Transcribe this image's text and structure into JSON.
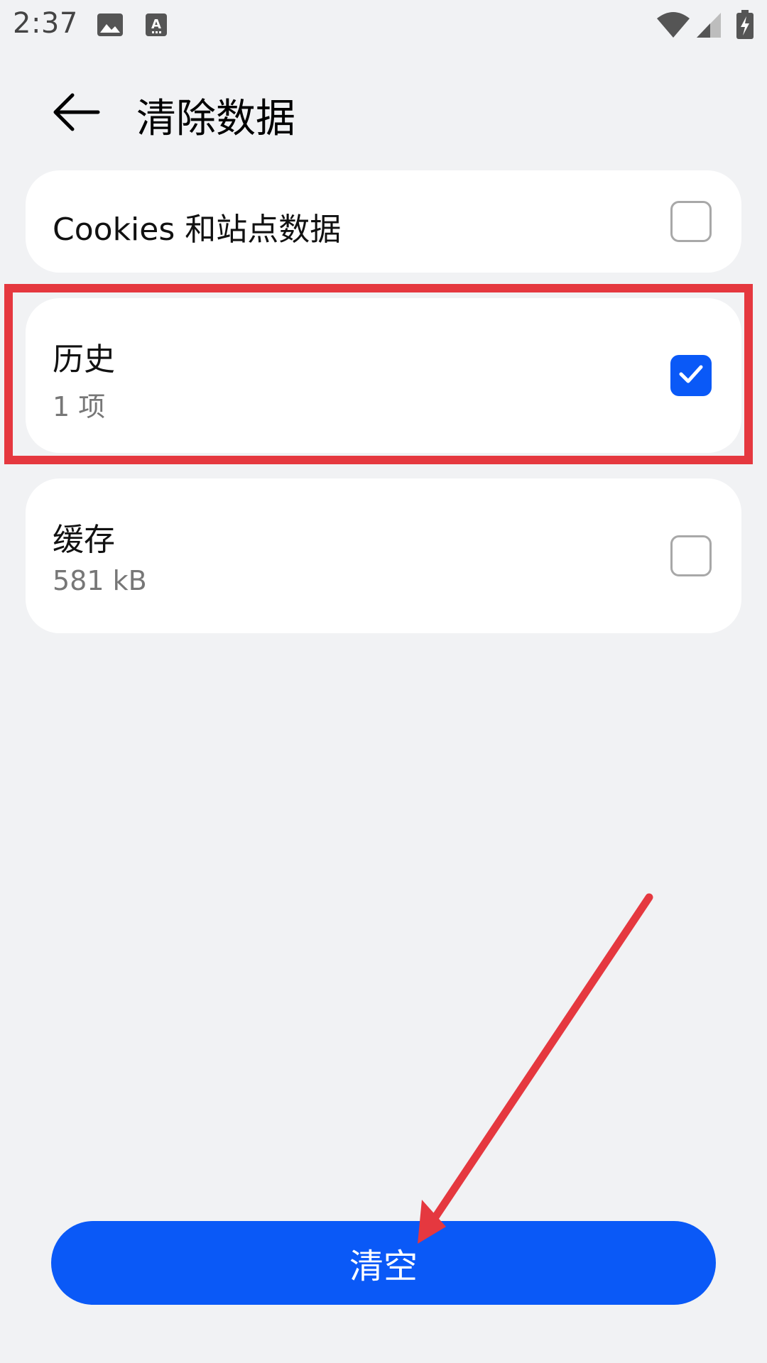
{
  "status_bar": {
    "time": "2:37",
    "icons": [
      "image-icon",
      "keyboard-a-icon",
      "wifi-icon",
      "signal-icon",
      "battery-charging-icon"
    ]
  },
  "header": {
    "back_icon": "arrow-left-icon",
    "title": "清除数据"
  },
  "options": [
    {
      "label": "Cookies 和站点数据",
      "detail": "",
      "checked": false
    },
    {
      "label": "历史",
      "detail": "1 项",
      "checked": true
    },
    {
      "label": "缓存",
      "detail": "581 kB",
      "checked": false
    }
  ],
  "actions": {
    "clear_label": "清空"
  },
  "colors": {
    "accent": "#0a59f7",
    "annotation": "#e5383f",
    "background": "#f1f2f4",
    "card": "#ffffff"
  }
}
